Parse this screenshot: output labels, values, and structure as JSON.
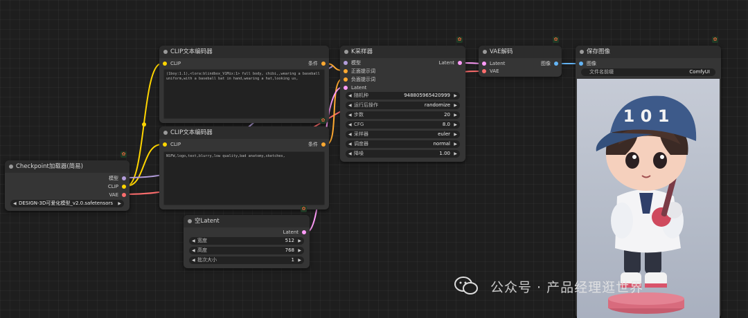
{
  "nodes": {
    "checkpoint": {
      "title": "Checkpoint加载器(简易)",
      "outputs": [
        "模型",
        "CLIP",
        "VAE"
      ],
      "ckpt_value": "DESIGN-3D可爱化模型_v2.0.safetensors"
    },
    "clip_pos": {
      "title": "CLIP文本编码器",
      "input": "CLIP",
      "output": "条件",
      "text": "(1boy:1.1),<lora:blindbox_V1Mix:1> full body, chibi,,wearing a baseball uniform,with a baseball bat in hand,wearing a hat,looking us,"
    },
    "clip_neg": {
      "title": "CLIP文本编码器",
      "input": "CLIP",
      "output": "条件",
      "text": "NSFW,logo,text,blurry,low quality,bad anatomy,sketches,"
    },
    "empty_latent": {
      "title": "空Latent",
      "output": "Latent",
      "widgets": [
        {
          "label": "宽度",
          "value": "512"
        },
        {
          "label": "高度",
          "value": "768"
        },
        {
          "label": "批次大小",
          "value": "1"
        }
      ]
    },
    "ksampler": {
      "title": "K采样器",
      "inputs": [
        "模型",
        "正面提示词",
        "负面提示词",
        "Latent"
      ],
      "output": "Latent",
      "widgets": [
        {
          "label": "随机种",
          "value": "948805965420999"
        },
        {
          "label": "运行后操作",
          "value": "randomize"
        },
        {
          "label": "步数",
          "value": "20"
        },
        {
          "label": "CFG",
          "value": "8.0"
        },
        {
          "label": "采样器",
          "value": "euler"
        },
        {
          "label": "调度器",
          "value": "normal"
        },
        {
          "label": "降噪",
          "value": "1.00"
        }
      ]
    },
    "vae_decode": {
      "title": "VAE解码",
      "inputs": [
        "Latent",
        "VAE"
      ],
      "output": "图像"
    },
    "save_image": {
      "title": "保存图像",
      "input": "图像",
      "prefix_label": "文件名前缀",
      "prefix_value": "ComfyUI",
      "image_text": "1 0 1"
    }
  },
  "watermark": "公众号 · 产品经理逛世界",
  "colors": {
    "model": "#b39ddb",
    "clip": "#ffd500",
    "vae": "#ff6e6e",
    "conditioning": "#ffa931",
    "latent": "#ff9cf9",
    "image": "#64b5f6"
  }
}
